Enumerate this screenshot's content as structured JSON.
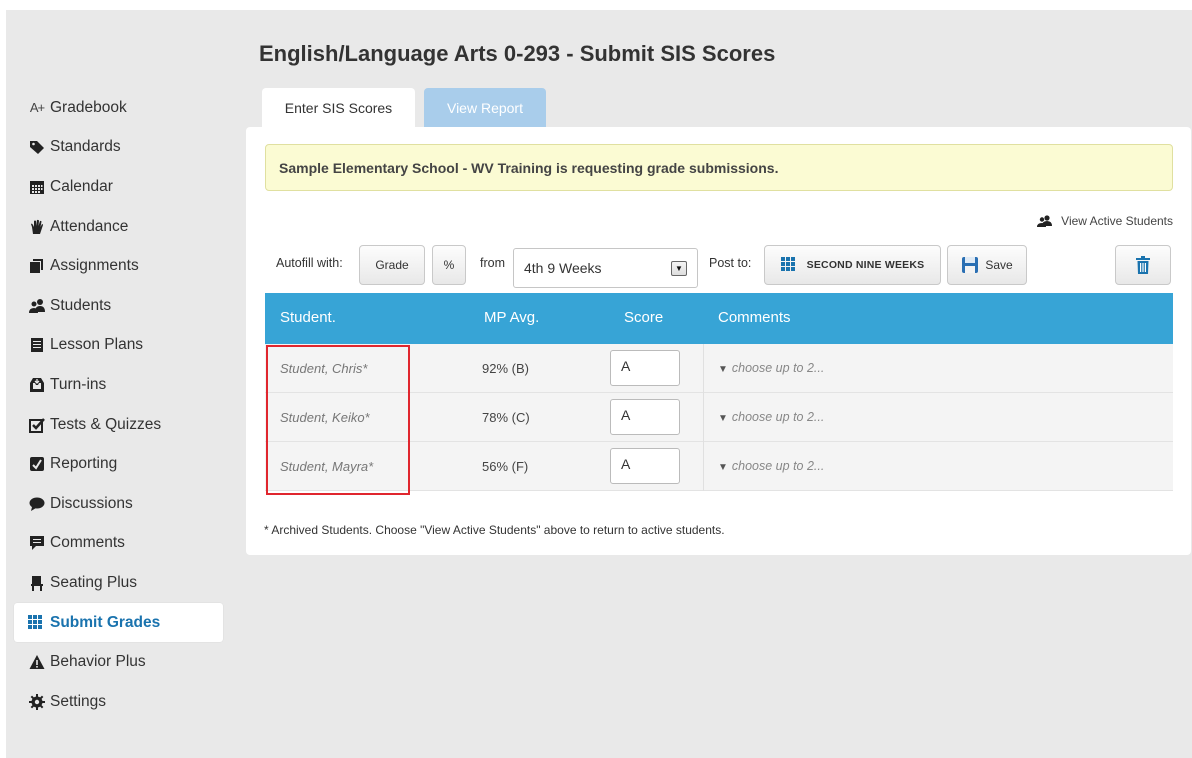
{
  "page": {
    "title": "English/Language Arts 0-293 - Submit SIS Scores"
  },
  "sidebar": {
    "items": [
      {
        "label": "Gradebook",
        "icon": "a-plus-icon"
      },
      {
        "label": "Standards",
        "icon": "tag-icon"
      },
      {
        "label": "Calendar",
        "icon": "calendar-icon"
      },
      {
        "label": "Attendance",
        "icon": "hand-icon"
      },
      {
        "label": "Assignments",
        "icon": "assignments-icon"
      },
      {
        "label": "Students",
        "icon": "students-icon"
      },
      {
        "label": "Lesson Plans",
        "icon": "book-icon"
      },
      {
        "label": "Turn-ins",
        "icon": "inbox-icon"
      },
      {
        "label": "Tests & Quizzes",
        "icon": "checkbox-icon"
      },
      {
        "label": "Reporting",
        "icon": "report-icon"
      },
      {
        "label": "Discussions",
        "icon": "speech-bubble-icon"
      },
      {
        "label": "Comments",
        "icon": "comment-icon"
      },
      {
        "label": "Seating Plus",
        "icon": "chair-icon"
      },
      {
        "label": "Submit Grades",
        "icon": "grid-icon",
        "active": true
      },
      {
        "label": "Behavior Plus",
        "icon": "warning-icon"
      },
      {
        "label": "Settings",
        "icon": "gear-icon"
      }
    ],
    "gradebook_prefix": "A+"
  },
  "tabs": {
    "enter": "Enter SIS Scores",
    "report": "View Report"
  },
  "notice": "Sample Elementary School - WV Training is requesting grade submissions.",
  "view_active": "View Active Students",
  "toolbar": {
    "autofill_label": "Autofill with:",
    "grade_btn": "Grade",
    "percent_btn": "%",
    "from_label": "from",
    "period_value": "4th 9 Weeks",
    "post_label": "Post to:",
    "post_target": "SECOND NINE WEEKS",
    "save_btn": "Save"
  },
  "table": {
    "headers": [
      "Student.",
      "MP Avg.",
      "Score",
      "Comments"
    ],
    "rows": [
      {
        "name": "Student, Chris*",
        "avg": "92% (B)",
        "score": "A",
        "comment": "choose up to 2..."
      },
      {
        "name": "Student, Keiko*",
        "avg": "78% (C)",
        "score": "A",
        "comment": "choose up to 2..."
      },
      {
        "name": "Student, Mayra*",
        "avg": "56% (F)",
        "score": "A",
        "comment": "choose up to 2..."
      }
    ]
  },
  "footnote": "* Archived Students. Choose \"View Active Students\" above to return to active students.",
  "colors": {
    "accent": "#37a4d6",
    "active_nav": "#1a73ae",
    "notice_bg": "#fbfbd3",
    "highlight": "#e0262e"
  }
}
